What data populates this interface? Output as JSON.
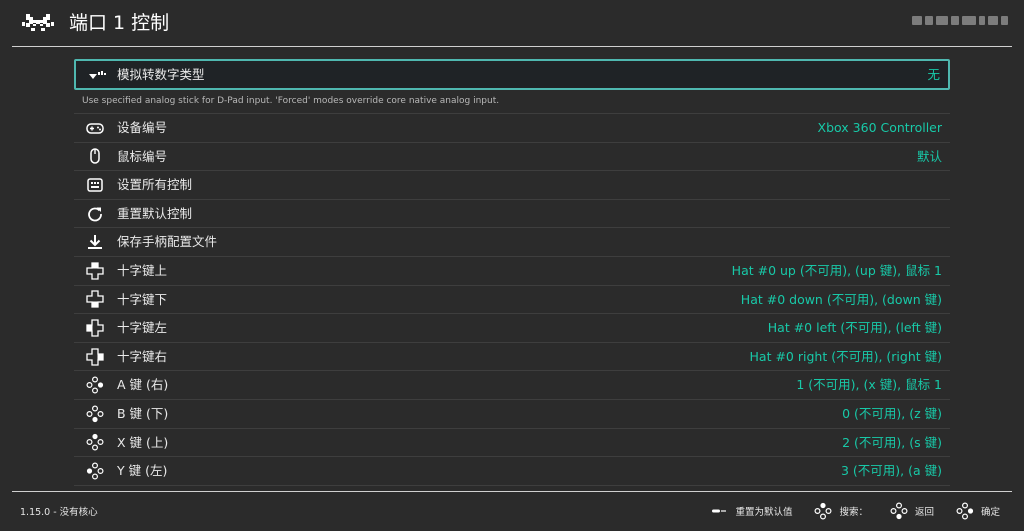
{
  "header": {
    "title": "端口 1 控制",
    "logo_icon": "retroarch-invader-icon"
  },
  "menu": {
    "items": [
      {
        "label": "模拟转数字类型",
        "value": "无",
        "icon": "analog-stick-icon",
        "selected": true,
        "sublabel": "Use specified analog stick for D-Pad input. 'Forced' modes override core native analog input."
      },
      {
        "label": "设备编号",
        "value": "Xbox 360 Controller",
        "icon": "gamepad-icon"
      },
      {
        "label": "鼠标编号",
        "value": "默认",
        "icon": "mouse-icon"
      },
      {
        "label": "设置所有控制",
        "value": "",
        "icon": "keyboard-icon"
      },
      {
        "label": "重置默认控制",
        "value": "",
        "icon": "reload-icon"
      },
      {
        "label": "保存手柄配置文件",
        "value": "",
        "icon": "download-icon"
      },
      {
        "label": "十字键上",
        "value": "Hat #0 up (不可用), (up 键), 鼠标 1",
        "icon": "dpad-up-icon"
      },
      {
        "label": "十字键下",
        "value": "Hat #0 down (不可用), (down 键)",
        "icon": "dpad-down-icon"
      },
      {
        "label": "十字键左",
        "value": "Hat #0 left (不可用), (left 键)",
        "icon": "dpad-left-icon"
      },
      {
        "label": "十字键右",
        "value": "Hat #0 right (不可用), (right 键)",
        "icon": "dpad-right-icon"
      },
      {
        "label": "A 键 (右)",
        "value": "1 (不可用), (x 键), 鼠标 1",
        "icon": "face-button-right-icon"
      },
      {
        "label": "B 键 (下)",
        "value": "0 (不可用), (z 键)",
        "icon": "face-button-down-icon"
      },
      {
        "label": "X 键 (上)",
        "value": "2 (不可用), (s 键)",
        "icon": "face-button-up-icon"
      },
      {
        "label": "Y 键 (左)",
        "value": "3 (不可用), (a 键)",
        "icon": "face-button-left-icon"
      }
    ]
  },
  "footer": {
    "version": "1.15.0 - 没有核心",
    "hints": {
      "reset": "重置为默认值",
      "search": "搜索：",
      "back": "返回",
      "ok": "确定"
    }
  },
  "colors": {
    "background": "#2b2b2b",
    "value_accent": "#18c9a8",
    "selection_border": "#4fb8b0"
  }
}
